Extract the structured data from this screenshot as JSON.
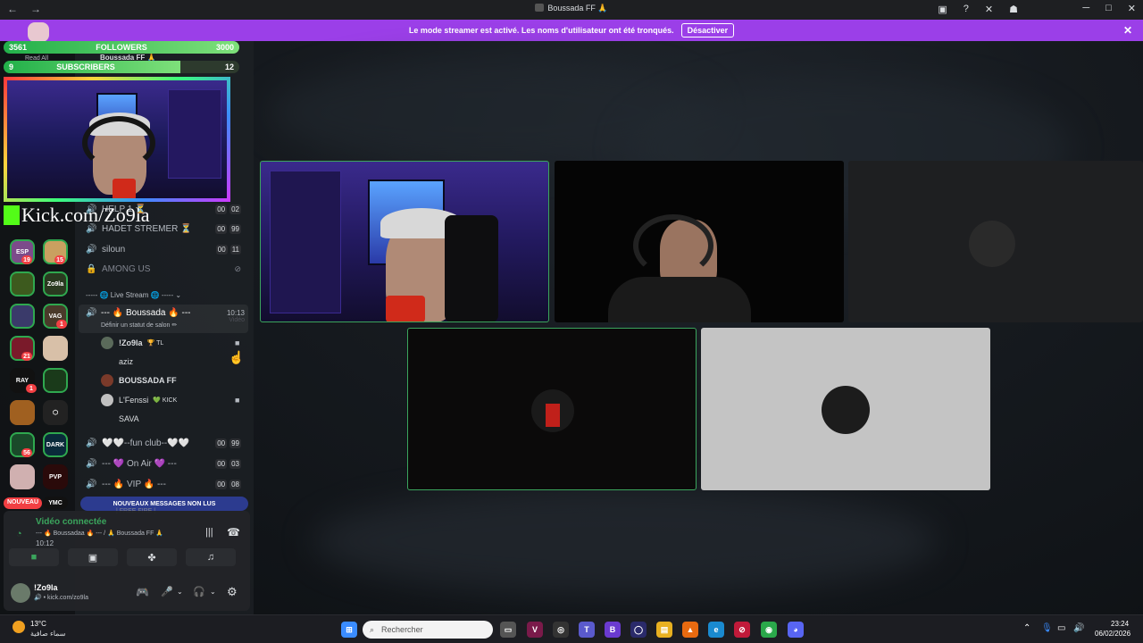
{
  "titlebar": {
    "title": "Boussada FF 🙏"
  },
  "banner": {
    "text": "Le mode streamer est activé. Les noms d'utilisateur ont été tronqués.",
    "button": "Désactiver"
  },
  "overlay": {
    "followers": {
      "left": "3561",
      "label": "FOLLOWERS",
      "right": "3000",
      "progress": 1.0
    },
    "subscribers": {
      "left": "9",
      "label": "SUBSCRIBERS",
      "right": "12",
      "progress": 0.75
    },
    "kick_text": "Kick.com/Zo9la",
    "read_all": "Read All",
    "header_fragment": "Boussada FF 🙏"
  },
  "guild_badges": [
    "19",
    "15",
    "1",
    "21",
    "1",
    "56"
  ],
  "guild_labels": [
    "Zo9la",
    "VAG",
    "RAY",
    "DARK",
    "YMC",
    "PVP"
  ],
  "channels": [
    {
      "name": "HELP 1 ⏳",
      "icon": "speaker-icon",
      "c1": "00",
      "c2": "02"
    },
    {
      "name": "HADET STREMER ⏳",
      "icon": "speaker-icon",
      "c1": "00",
      "c2": "99"
    },
    {
      "name": "siloun",
      "icon": "speaker-icon",
      "c1": "00",
      "c2": "11"
    },
    {
      "name": "AMONG US",
      "icon": "lock-icon",
      "c1": "",
      "c2": ""
    }
  ],
  "category": "----- 🌐 Live Stream 🌐 ----- ⌄",
  "active_channel": {
    "name": "--- 🔥 Boussada 🔥 ---",
    "time": "10:13",
    "status": "Définir un statut de salon ✏",
    "tag": "Vidéo"
  },
  "voice_users": [
    {
      "name": "!Zo9la",
      "tag": "🏆 TL",
      "cam": true
    },
    {
      "name": "aziz",
      "tag": "",
      "cam": false
    },
    {
      "name": "BOUSSADA FF",
      "tag": "",
      "cam": false
    },
    {
      "name": "L'Fenssi",
      "tag": "💚 KICK",
      "cam": true
    },
    {
      "name": "SAVA",
      "tag": "",
      "cam": false
    }
  ],
  "channels_bottom": [
    {
      "name": "🤍🤍--fun club--🤍🤍",
      "c1": "00",
      "c2": "99"
    },
    {
      "name": "--- 💜 On Air 💜 ---",
      "c1": "00",
      "c2": "03"
    },
    {
      "name": "--- 🔥 VIP 🔥 ---",
      "c1": "00",
      "c2": "08"
    }
  ],
  "nouveau": "NOUVEAU",
  "new_messages": "NOUVEAUX MESSAGES NON LUS",
  "free_fire_fragment": "| FREE FIRE |",
  "voice_panel": {
    "status": "Vidéo connectée",
    "channel": "--- 🔥 Boussadaa 🔥 --- / 🙏 Boussada FF 🙏",
    "time": "10:12"
  },
  "user": {
    "name": "!Zo9la",
    "sub": "🔊 • kick.com/zo9la"
  },
  "taskbar": {
    "temp": "13°C",
    "weather": "سماء صافية",
    "search": "Rechercher",
    "time": "23:24",
    "date": "06/02/2026"
  }
}
